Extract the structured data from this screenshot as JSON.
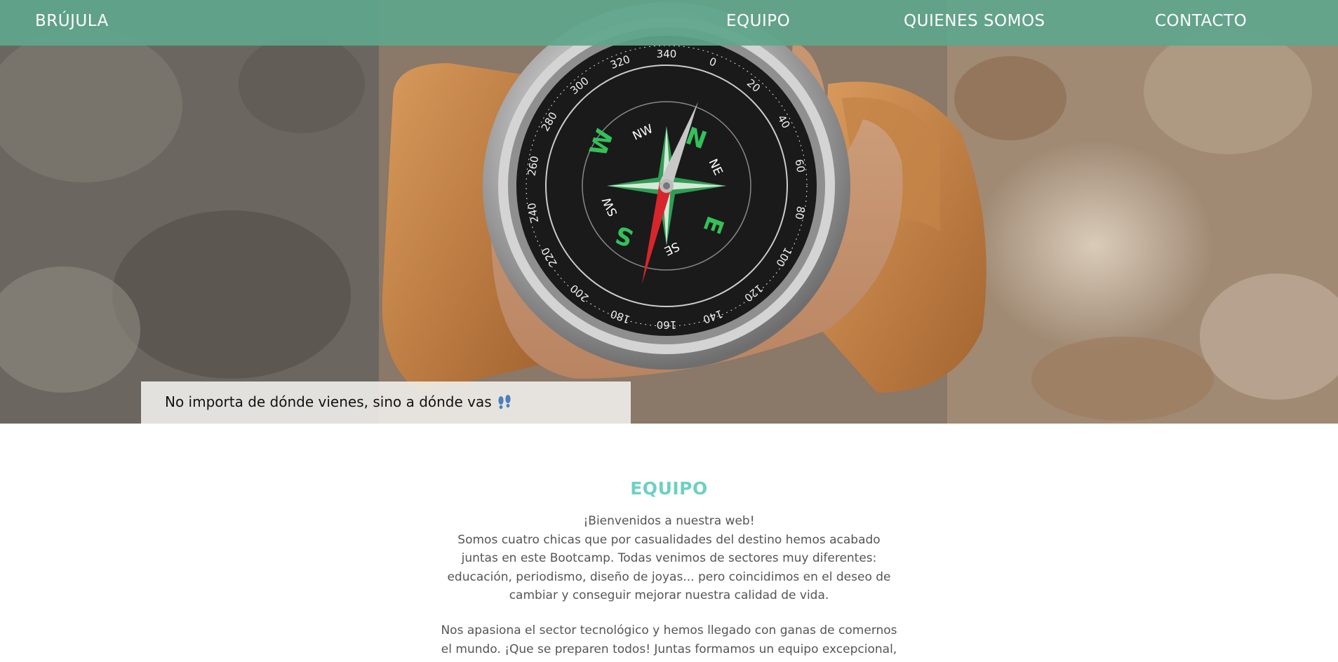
{
  "nav": {
    "brand": "BRÚJULA",
    "links": [
      "EQUIPO",
      "QUIENES SOMOS",
      "CONTACTO"
    ]
  },
  "hero": {
    "caption": "No importa de dónde vienes, sino a dónde vas",
    "caption_icon": "footprints-icon",
    "compass_labels": {
      "cardinals": [
        "N",
        "E",
        "S",
        "W"
      ],
      "intercardinals": [
        "NE",
        "SE",
        "SW",
        "NW"
      ],
      "degrees": [
        "0",
        "20",
        "40",
        "60",
        "80",
        "100",
        "120",
        "140",
        "160",
        "180",
        "200",
        "220",
        "240",
        "260",
        "280",
        "300",
        "320",
        "340"
      ]
    }
  },
  "equipo": {
    "title": "EQUIPO",
    "paragraph1": [
      "¡Bienvenidos a nuestra web!",
      "Somos cuatro chicas que por casualidades del destino hemos acabado",
      "juntas en este Bootcamp. Todas venimos de sectores muy diferentes:",
      "educación, periodismo, diseño de joyas... pero coincidimos en el deseo de",
      "cambiar y conseguir mejorar nuestra calidad de vida."
    ],
    "paragraph2": [
      "Nos apasiona el sector tecnológico y hemos llegado con ganas de comernos",
      "el mundo. ¡Que se preparen todos! Juntas formamos un equipo excepcional,"
    ]
  },
  "colors": {
    "nav_bg": "#5fa68c",
    "accent": "#6ed0c4",
    "body_text": "#555555",
    "compass_green": "#3fbf5a",
    "needle_red": "#d7262b"
  }
}
